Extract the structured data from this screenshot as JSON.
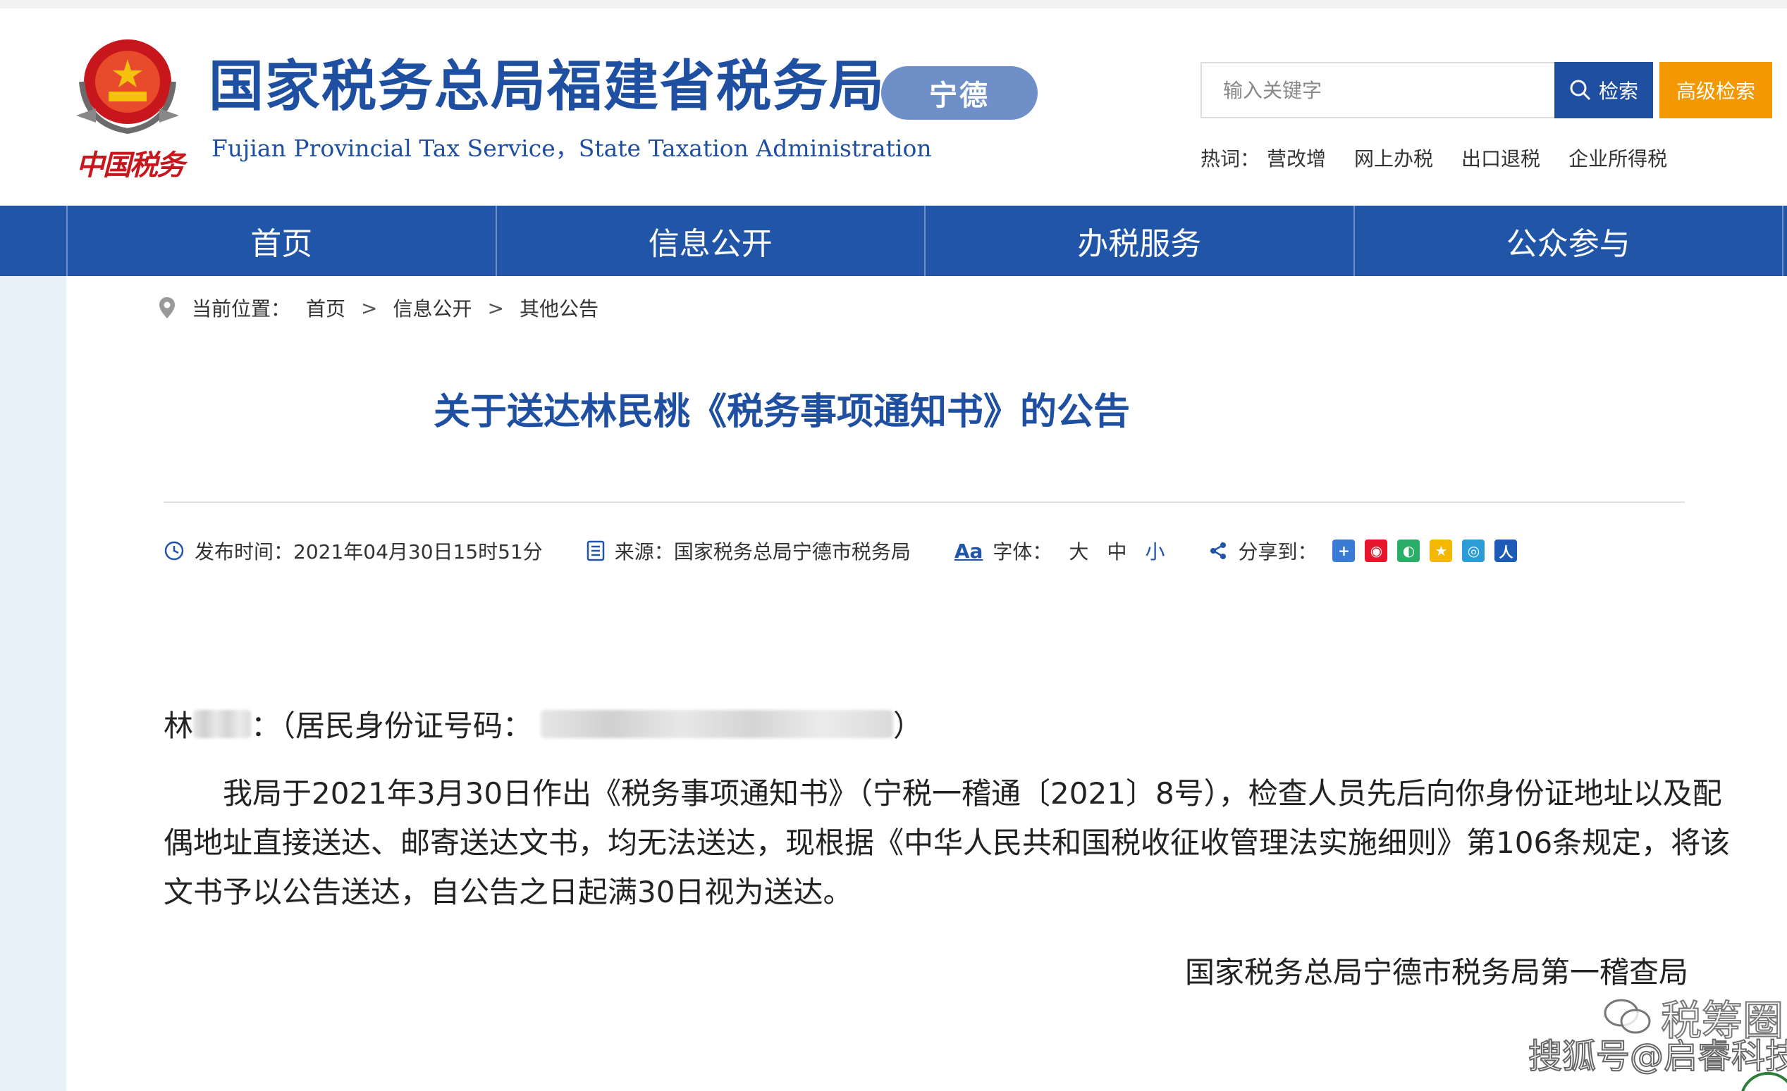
{
  "header": {
    "emblem_caption": "中国税务",
    "site_title": "国家税务总局福建省税务局",
    "site_subtitle": "Fujian Provincial Tax Service，State Taxation Administration",
    "city_badge": "宁德",
    "search": {
      "placeholder": "输入关键字",
      "button_label": "检索",
      "advanced_label": "高级检索"
    },
    "hotwords": {
      "label": "热词：",
      "items": [
        "营改增",
        "网上办税",
        "出口退税",
        "企业所得税"
      ]
    }
  },
  "nav": {
    "items": [
      "首页",
      "信息公开",
      "办税服务",
      "公众参与"
    ]
  },
  "breadcrumb": {
    "label": "当前位置：",
    "items": [
      "首页",
      "信息公开",
      "其他公告"
    ],
    "separator": ">"
  },
  "article": {
    "title": "关于送达林民桃《税务事项通知书》的公告",
    "meta": {
      "publish_label": "发布时间：",
      "publish_time": "2021年04月30日15时51分",
      "source_label": "来源：",
      "source": "国家税务总局宁德市税务局",
      "font_icon_text": "Aa",
      "font_label": "字体：",
      "font_options": [
        "大",
        "中",
        "小"
      ],
      "share_label": "分享到："
    },
    "salutation_prefix": "林",
    "salutation_mid": "：（居民身份证号码：",
    "salutation_suffix": "）",
    "paragraph": "我局于2021年3月30日作出《税务事项通知书》（宁税一稽通〔2021〕8号），检查人员先后向你身份证地址以及配偶地址直接送达、邮寄送达文书，均无法送达，现根据《中华人民共和国税收征收管理法实施细则》第106条规定，将该文书予以公告送达，自公告之日起满30日视为送达。",
    "signature": "国家税务总局宁德市税务局第一稽查局"
  },
  "watermark": {
    "line1": "税筹圈",
    "line2": "搜狐号@启睿科技"
  },
  "colors": {
    "brand_blue": "#2155a8",
    "title_blue": "#1f4fa0",
    "advanced_orange": "#f39800",
    "emblem_red": "#c8161d"
  }
}
